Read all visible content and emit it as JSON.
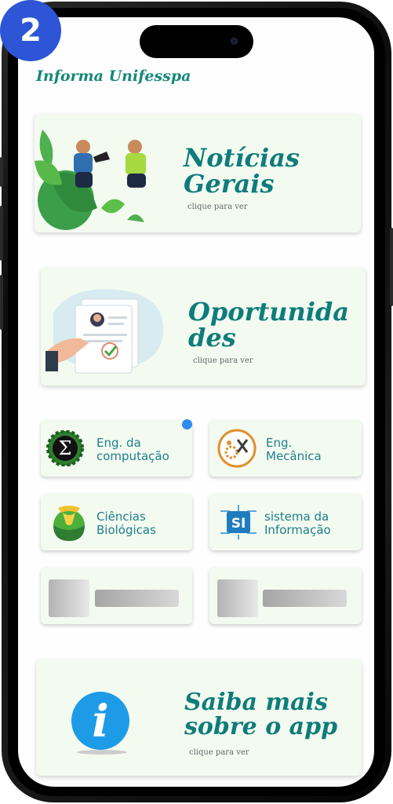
{
  "step_badge": "2",
  "app_title": "Informa Unifesspa",
  "cards": {
    "noticias": {
      "title_line1": "Notícias",
      "title_line2": "Gerais",
      "hint": "clique para ver"
    },
    "oportunidades": {
      "title_line1": "Oportunida",
      "title_line2": "des",
      "hint": "clique para ver"
    },
    "saiba": {
      "title_line1": "Saiba mais",
      "title_line2": "sobre o app",
      "hint": "clique para ver"
    }
  },
  "courses": [
    {
      "line1": "Eng. da",
      "line2": "computação",
      "icon": "sigma-gear-icon"
    },
    {
      "line1": "Eng.",
      "line2": "Mecânica",
      "icon": "gear-tools-icon"
    },
    {
      "line1": "Ciências",
      "line2": "Biológicas",
      "icon": "biology-flask-icon"
    },
    {
      "line1": "sistema da",
      "line2": "Informação",
      "icon": "si-circuit-icon"
    }
  ],
  "colors": {
    "accent": "#0e7c7b",
    "card_bg": "#f3faf0",
    "badge": "#2d55d6",
    "notification": "#2d8cf0"
  }
}
